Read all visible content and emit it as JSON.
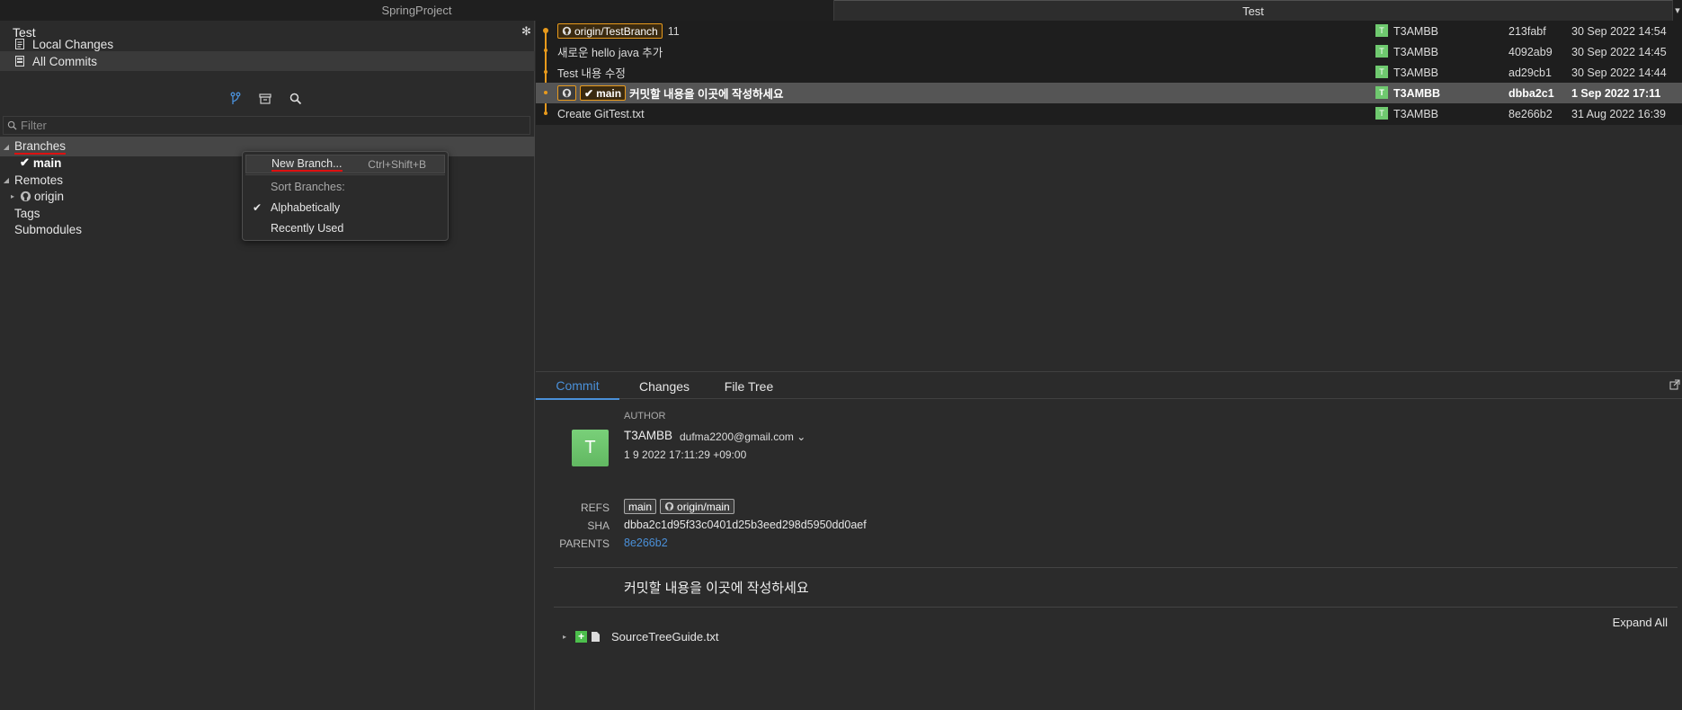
{
  "tabs": [
    {
      "label": "SpringProject"
    },
    {
      "label": "Test"
    }
  ],
  "sidebar": {
    "repo_title": "Test",
    "items": [
      {
        "label": "Local Changes"
      },
      {
        "label": "All Commits"
      }
    ],
    "filter_placeholder": "Filter",
    "tree": {
      "branches": "Branches",
      "main": "main",
      "remotes": "Remotes",
      "origin": "origin",
      "tags": "Tags",
      "submodules": "Submodules"
    }
  },
  "context_menu": {
    "new_branch": "New Branch...",
    "new_branch_shortcut": "Ctrl+Shift+B",
    "sort_header": "Sort Branches:",
    "alphabetically": "Alphabetically",
    "recently_used": "Recently Used"
  },
  "commits": [
    {
      "badges": [
        "origin/TestBranch"
      ],
      "count": "11",
      "message": "",
      "author": "T3AMBB",
      "avatar": "T",
      "sha": "213fabf",
      "date": "30 Sep 2022 14:54"
    },
    {
      "badges": [],
      "count": "",
      "message": "새로운 hello java 추가",
      "author": "T3AMBB",
      "avatar": "T",
      "sha": "4092ab9",
      "date": "30 Sep 2022 14:45"
    },
    {
      "badges": [],
      "count": "",
      "message": "Test 내용 수정",
      "author": "T3AMBB",
      "avatar": "T",
      "sha": "ad29cb1",
      "date": "30 Sep 2022 14:44"
    },
    {
      "badges": [
        "main"
      ],
      "count": "",
      "message": "커밋할 내용을 이곳에 작성하세요",
      "author": "T3AMBB",
      "avatar": "T",
      "sha": "dbba2c1",
      "date": "1 Sep 2022 17:11"
    },
    {
      "badges": [],
      "count": "",
      "message": "Create GitTest.txt",
      "author": "T3AMBB",
      "avatar": "T",
      "sha": "8e266b2",
      "date": "31 Aug 2022 16:39"
    }
  ],
  "details": {
    "tabs": [
      "Commit",
      "Changes",
      "File Tree"
    ],
    "author_header": "AUTHOR",
    "avatar": "T",
    "author_name": "T3AMBB",
    "author_email": "dufma2200@gmail.com ⌄",
    "author_date": "1 9 2022 17:11:29 +09:00",
    "refs_label": "REFS",
    "refs": [
      "main",
      "origin/main"
    ],
    "sha_label": "SHA",
    "sha": "dbba2c1d95f33c0401d25b3eed298d5950dd0aef",
    "parents_label": "PARENTS",
    "parents": "8e266b2",
    "message": "커밋할 내용을 이곳에 작성하세요",
    "expand_all": "Expand All",
    "file": "SourceTreeGuide.txt"
  },
  "colors": {
    "accent": "#4a90d9",
    "graph": "#e89a1c",
    "avatar": "#6dc86d"
  }
}
